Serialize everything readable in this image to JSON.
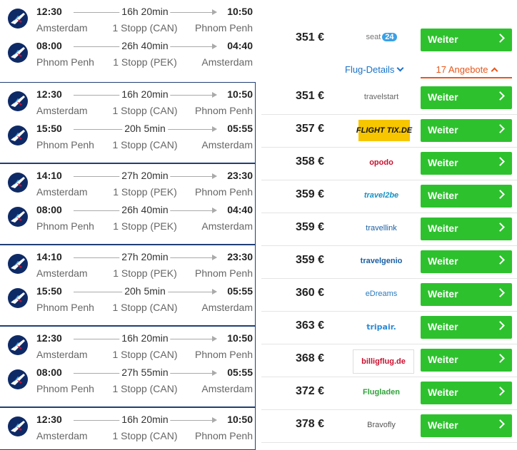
{
  "itineraries": [
    {
      "outbound": {
        "dep_time": "12:30",
        "dep_place": "Amsterdam",
        "duration": "16h 20min",
        "stops": "1 Stopp (CAN)",
        "arr_time": "10:50",
        "arr_place": "Phnom Penh"
      },
      "return": {
        "dep_time": "08:00",
        "dep_place": "Phnom Penh",
        "duration": "26h 40min",
        "stops": "1 Stopp (PEK)",
        "arr_time": "04:40",
        "arr_place": "Amsterdam"
      }
    },
    {
      "outbound": {
        "dep_time": "12:30",
        "dep_place": "Amsterdam",
        "duration": "16h 20min",
        "stops": "1 Stopp (CAN)",
        "arr_time": "10:50",
        "arr_place": "Phnom Penh"
      },
      "return": {
        "dep_time": "15:50",
        "dep_place": "Phnom Penh",
        "duration": "20h 5min",
        "stops": "1 Stopp (CAN)",
        "arr_time": "05:55",
        "arr_place": "Amsterdam"
      }
    },
    {
      "outbound": {
        "dep_time": "14:10",
        "dep_place": "Amsterdam",
        "duration": "27h 20min",
        "stops": "1 Stopp (PEK)",
        "arr_time": "23:30",
        "arr_place": "Phnom Penh"
      },
      "return": {
        "dep_time": "08:00",
        "dep_place": "Phnom Penh",
        "duration": "26h 40min",
        "stops": "1 Stopp (PEK)",
        "arr_time": "04:40",
        "arr_place": "Amsterdam"
      }
    },
    {
      "outbound": {
        "dep_time": "14:10",
        "dep_place": "Amsterdam",
        "duration": "27h 20min",
        "stops": "1 Stopp (PEK)",
        "arr_time": "23:30",
        "arr_place": "Phnom Penh"
      },
      "return": {
        "dep_time": "15:50",
        "dep_place": "Phnom Penh",
        "duration": "20h 5min",
        "stops": "1 Stopp (CAN)",
        "arr_time": "05:55",
        "arr_place": "Amsterdam"
      }
    },
    {
      "outbound": {
        "dep_time": "12:30",
        "dep_place": "Amsterdam",
        "duration": "16h 20min",
        "stops": "1 Stopp (CAN)",
        "arr_time": "10:50",
        "arr_place": "Phnom Penh"
      },
      "return": {
        "dep_time": "08:00",
        "dep_place": "Phnom Penh",
        "duration": "27h 55min",
        "stops": "1 Stopp (CAN)",
        "arr_time": "05:55",
        "arr_place": "Amsterdam"
      }
    },
    {
      "outbound": {
        "dep_time": "12:30",
        "dep_place": "Amsterdam",
        "duration": "16h 20min",
        "stops": "1 Stopp (CAN)",
        "arr_time": "10:50",
        "arr_place": "Phnom Penh"
      }
    }
  ],
  "top_offer": {
    "price": "351 €",
    "provider": {
      "name": "seat",
      "suffix": "24"
    },
    "button_label": "Weiter",
    "details_link": "Flug-Details",
    "offers_link": "17 Angebote"
  },
  "offers": [
    {
      "price": "351 €",
      "provider": "travelstart",
      "button_label": "Weiter"
    },
    {
      "price": "357 €",
      "provider": "FLIGHT TIX.DE",
      "button_label": "Weiter"
    },
    {
      "price": "358 €",
      "provider": "opodo",
      "button_label": "Weiter"
    },
    {
      "price": "359 €",
      "provider": "travel2be",
      "button_label": "Weiter"
    },
    {
      "price": "359 €",
      "provider": "travellink",
      "button_label": "Weiter"
    },
    {
      "price": "359 €",
      "provider": "travelgenio",
      "button_label": "Weiter"
    },
    {
      "price": "360 €",
      "provider": "eDreams",
      "button_label": "Weiter"
    },
    {
      "price": "363 €",
      "provider": "tripair.",
      "button_label": "Weiter"
    },
    {
      "price": "368 €",
      "provider": "billigflug.de",
      "button_label": "Weiter"
    },
    {
      "price": "372 €",
      "provider": "Flugladen",
      "button_label": "Weiter"
    },
    {
      "price": "378 €",
      "provider": "Bravofly",
      "button_label": "Weiter"
    }
  ],
  "colors": {
    "button_green": "#2ec12e",
    "link_blue": "#1a73c8",
    "accent_orange": "#e8561b",
    "card_border": "#1f3f74",
    "airline_navy": "#0e2a66"
  },
  "icons": {
    "airline_logo": "airline-tail-icon",
    "chevron": "chevron-right-icon"
  }
}
